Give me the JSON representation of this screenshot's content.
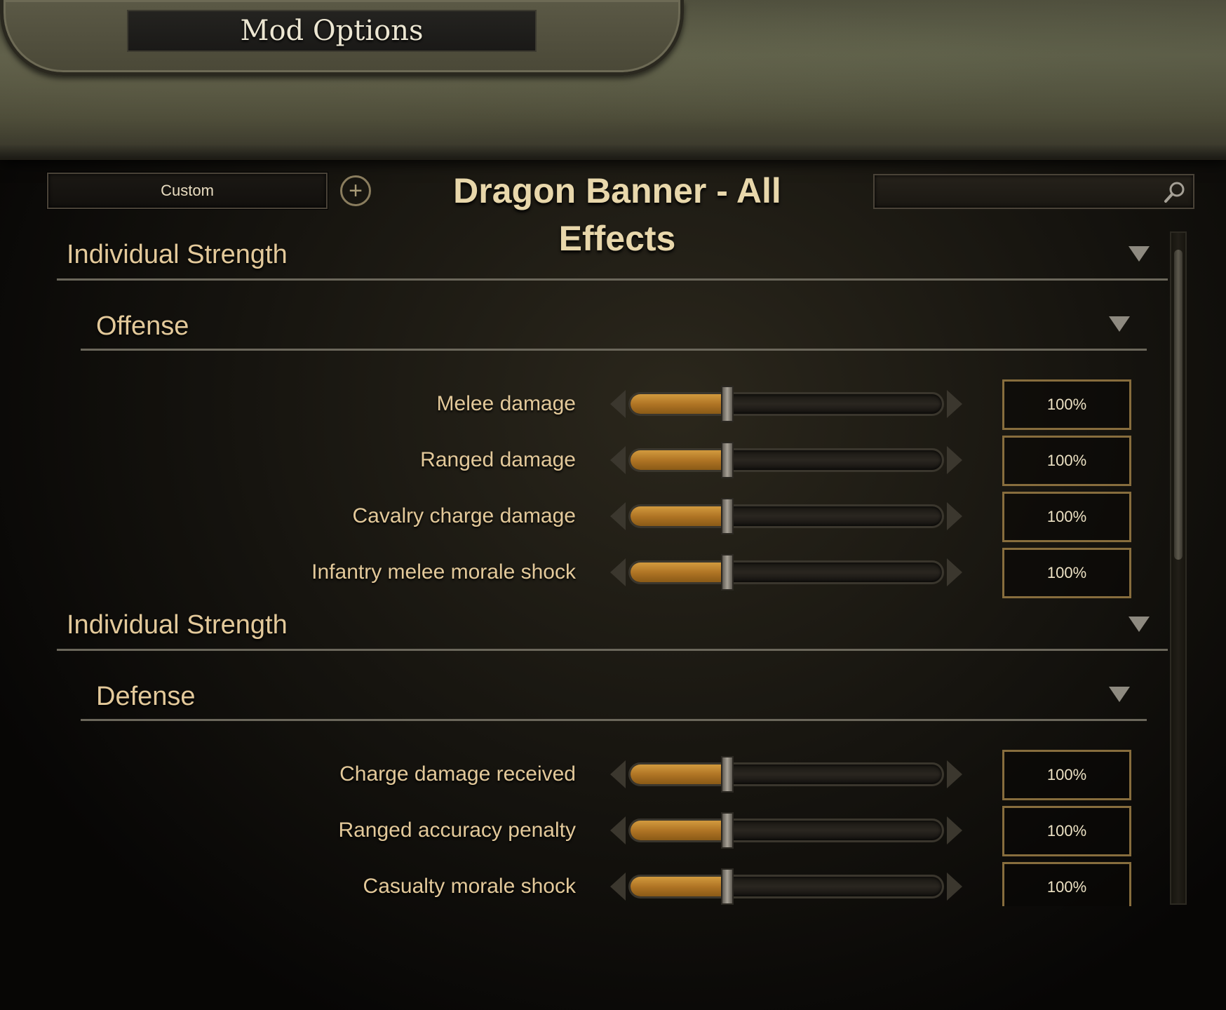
{
  "window": {
    "title": "Mod Options"
  },
  "header": {
    "preset_label": "Custom",
    "mod_title": "Dragon Banner - All Effects",
    "search_placeholder": ""
  },
  "sections": [
    {
      "title": "Individual Strength",
      "subgroup": "Offense",
      "settings": [
        {
          "label": "Melee damage",
          "value": "100%",
          "level": 0.31
        },
        {
          "label": "Ranged damage",
          "value": "100%",
          "level": 0.31
        },
        {
          "label": "Cavalry charge damage",
          "value": "100%",
          "level": 0.31
        },
        {
          "label": "Infantry melee morale shock",
          "value": "100%",
          "level": 0.31
        }
      ]
    },
    {
      "title": "Individual Strength",
      "subgroup": "Defense",
      "settings": [
        {
          "label": "Charge damage received",
          "value": "100%",
          "level": 0.31
        },
        {
          "label": "Ranged accuracy penalty",
          "value": "100%",
          "level": 0.31
        },
        {
          "label": "Casualty morale shock",
          "value": "100%",
          "level": 0.31
        }
      ]
    }
  ],
  "icons": {
    "add": "plus-circle-icon",
    "search": "magnifier-icon",
    "collapse": "triangle-down-icon"
  },
  "colors": {
    "accent_gold": "#e3c99a",
    "slider_fill": "#b07525",
    "value_border": "#876d3d"
  }
}
